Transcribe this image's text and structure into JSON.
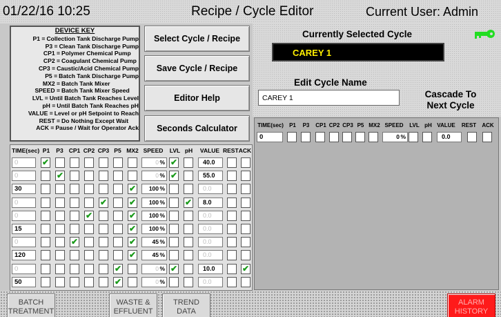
{
  "header": {
    "datetime": "01/22/16 10:25",
    "title": "Recipe / Cycle Editor",
    "user": "Current User: Admin"
  },
  "device_key": {
    "title": "DEVICE KEY",
    "entries": [
      {
        "code": "P1 =",
        "desc": "Collection Tank Discharge Pump"
      },
      {
        "code": "P3 =",
        "desc": "Clean Tank Discharge Pump"
      },
      {
        "code": "CP1 =",
        "desc": "Polymer Chemical Pump"
      },
      {
        "code": "CP2 =",
        "desc": "Coagulant Chemical Pump"
      },
      {
        "code": "CP3 =",
        "desc": "Caustic/Acid Chemical Pump"
      },
      {
        "code": "P5 =",
        "desc": "Batch Tank Discharge Pump"
      },
      {
        "code": "MX2 =",
        "desc": "Batch Tank Mixer"
      },
      {
        "code": "SPEED =",
        "desc": "Batch Tank Mixer Speed"
      },
      {
        "code": "LVL =",
        "desc": "Until Batch Tank Reaches Level"
      },
      {
        "code": "pH =",
        "desc": "Until Batch Tank Reaches pH"
      },
      {
        "code": "VALUE =",
        "desc": "Level or pH Setpoint to Reach"
      },
      {
        "code": "REST =",
        "desc": "Do Nothing Except Wait"
      },
      {
        "code": "ACK =",
        "desc": "Pause / Wait for Operator Ack"
      }
    ]
  },
  "buttons": {
    "select": "Select Cycle / Recipe",
    "save": "Save Cycle / Recipe",
    "help": "Editor Help",
    "seconds": "Seconds Calculator"
  },
  "editor": {
    "current_label": "Currently Selected Cycle",
    "current_value": "CAREY 1",
    "edit_label": "Edit Cycle Name",
    "edit_value": "CAREY 1",
    "cascade_label": "Cascade To Next Cycle"
  },
  "columns": [
    "TIME(sec)",
    "P1",
    "P3",
    "CP1",
    "CP2",
    "CP3",
    "P5",
    "MX2",
    "SPEED",
    "LVL",
    "pH",
    "VALUE",
    "REST",
    "ACK"
  ],
  "speed_unit": "%",
  "rows": [
    {
      "time": "0",
      "checks": [
        true,
        false,
        false,
        false,
        false,
        false,
        false
      ],
      "speed": "0",
      "lvl": true,
      "ph": false,
      "value": "40.0",
      "rest": false,
      "ack": false
    },
    {
      "time": "0",
      "checks": [
        false,
        true,
        false,
        false,
        false,
        false,
        false
      ],
      "speed": "0",
      "lvl": true,
      "ph": false,
      "value": "55.0",
      "rest": false,
      "ack": false
    },
    {
      "time": "30",
      "checks": [
        false,
        false,
        false,
        false,
        false,
        false,
        true
      ],
      "speed": "100",
      "lvl": false,
      "ph": false,
      "value": "0.0",
      "rest": false,
      "ack": false
    },
    {
      "time": "0",
      "checks": [
        false,
        false,
        false,
        false,
        true,
        false,
        true
      ],
      "speed": "100",
      "lvl": false,
      "ph": true,
      "value": "8.0",
      "rest": false,
      "ack": false
    },
    {
      "time": "0",
      "checks": [
        false,
        false,
        false,
        true,
        false,
        false,
        true
      ],
      "speed": "100",
      "lvl": false,
      "ph": false,
      "value": "0.0",
      "rest": false,
      "ack": false
    },
    {
      "time": "15",
      "checks": [
        false,
        false,
        false,
        false,
        false,
        false,
        true
      ],
      "speed": "100",
      "lvl": false,
      "ph": false,
      "value": "0.0",
      "rest": false,
      "ack": false
    },
    {
      "time": "0",
      "checks": [
        false,
        false,
        true,
        false,
        false,
        false,
        true
      ],
      "speed": "45",
      "lvl": false,
      "ph": false,
      "value": "0.0",
      "rest": false,
      "ack": false
    },
    {
      "time": "120",
      "checks": [
        false,
        false,
        false,
        false,
        false,
        false,
        true
      ],
      "speed": "45",
      "lvl": false,
      "ph": false,
      "value": "0.0",
      "rest": false,
      "ack": false
    },
    {
      "time": "0",
      "checks": [
        false,
        false,
        false,
        false,
        false,
        true,
        false
      ],
      "speed": "0",
      "lvl": true,
      "ph": false,
      "value": "10.0",
      "rest": false,
      "ack": true
    },
    {
      "time": "50",
      "checks": [
        false,
        false,
        false,
        false,
        false,
        true,
        false
      ],
      "speed": "0",
      "lvl": false,
      "ph": false,
      "value": "0.0",
      "rest": false,
      "ack": false
    }
  ],
  "cascade_row": {
    "time": "0",
    "speed": "0",
    "value": "0.0"
  },
  "nav": {
    "batch": "BATCH TREATMENT",
    "waste": "WASTE & EFFLUENT",
    "trend": "TREND DATA",
    "alarm": "ALARM HISTORY"
  },
  "colors": {
    "check": "#1a9a1a",
    "current_cycle_text": "#ffee00",
    "alarm": "#ff1a1a",
    "key_icon": "#22dd22"
  },
  "icons": {
    "key": "key-icon"
  }
}
